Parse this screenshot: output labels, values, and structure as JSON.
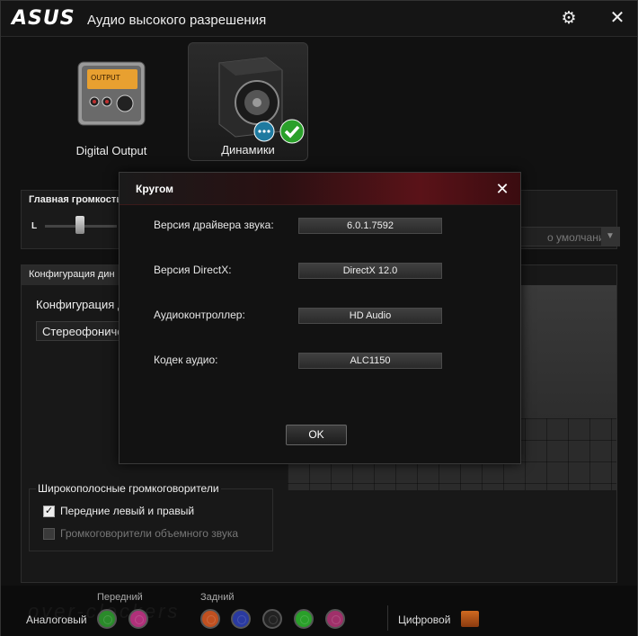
{
  "app": {
    "logo": "ASUS",
    "title": "Аудио высокого разрешения"
  },
  "devices": [
    {
      "label": "Digital Output",
      "selected": false
    },
    {
      "label": "Динамики",
      "selected": true
    }
  ],
  "volume": {
    "label": "Главная громкость",
    "channel_left": "L",
    "default_select": "о умолчанию"
  },
  "config": {
    "tab_label": "Конфигурация дин",
    "sub_label": "Конфигурация д",
    "select_value": "Стереофоничес",
    "wideband_title": "Широкополосные громкоговорители",
    "checkbox_front": {
      "label": "Передние левый и правый",
      "checked": true
    },
    "checkbox_surround": {
      "label": "Громкоговорители объемного звука",
      "checked": false
    }
  },
  "jacks": {
    "analog_label": "Аналоговый",
    "front_label": "Передний",
    "rear_label": "Задний",
    "digital_label": "Цифровой",
    "front_colors": [
      "#2a8a2a",
      "#b0307a"
    ],
    "rear_colors": [
      "#c05020",
      "#2a3aa0",
      "#222222",
      "#2aa02a",
      "#a0306a"
    ]
  },
  "watermark": "over-clockers",
  "dialog": {
    "title": "Кругом",
    "rows": [
      {
        "label": "Версия драйвера звука:",
        "value": "6.0.1.7592"
      },
      {
        "label": "Версия DirectX:",
        "value": "DirectX 12.0"
      },
      {
        "label": "Аудиоконтроллер:",
        "value": "HD Audio"
      },
      {
        "label": "Кодек аудио:",
        "value": "ALC1150"
      }
    ],
    "ok_label": "OK"
  },
  "colors": {
    "accent_red": "#5a1218",
    "check_green": "#2aa02a"
  }
}
